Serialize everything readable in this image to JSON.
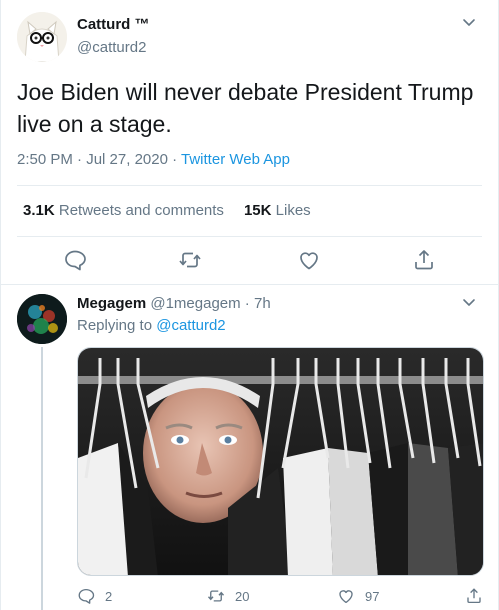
{
  "tweet": {
    "author": {
      "name": "Catturd ™",
      "handle": "@catturd2"
    },
    "text": "Joe Biden will never debate President Trump live on a stage.",
    "time": "2:50 PM",
    "separator": " · ",
    "date": "Jul 27, 2020",
    "separator2": " · ",
    "source": "Twitter Web App",
    "stats": {
      "retweets_count": "3.1K",
      "retweets_label": "Retweets and comments",
      "likes_count": "15K",
      "likes_label": "Likes"
    },
    "actions": [
      "reply-icon",
      "retweet-icon",
      "like-icon",
      "share-icon"
    ]
  },
  "reply": {
    "author": {
      "name": "Megagem",
      "handle": "@1megagem",
      "age_sep": " · ",
      "age": "7h"
    },
    "replying_label": "Replying to ",
    "replying_to": "@catturd2",
    "counts": {
      "replies": "2",
      "retweets": "20",
      "likes": "97"
    }
  },
  "colors": {
    "text": "#14171a",
    "secondary": "#657786",
    "link": "#1b95e0",
    "border": "#e6ecf0"
  }
}
